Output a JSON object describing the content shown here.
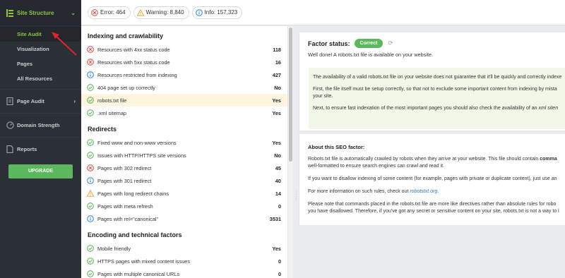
{
  "sidebar": {
    "section_title": "Site Structure",
    "sub_items": [
      {
        "label": "Site Audit",
        "active": true
      },
      {
        "label": "Visualization",
        "active": false
      },
      {
        "label": "Pages",
        "active": false
      },
      {
        "label": "All Resources",
        "active": false
      }
    ],
    "items": [
      {
        "label": "Page Audit",
        "icon": "page-audit-icon",
        "has_chevron": true
      },
      {
        "label": "Domain Strength",
        "icon": "gauge-icon",
        "has_chevron": false
      },
      {
        "label": "Reports",
        "icon": "report-icon",
        "has_chevron": false
      }
    ],
    "upgrade_label": "UPGRADE"
  },
  "topbar": {
    "error": "Error: 464",
    "warning": "Warning: 8,840",
    "info": "Info: 157,323"
  },
  "list": {
    "sections": [
      {
        "title": "Indexing and crawlability",
        "rows": [
          {
            "status": "error",
            "label": "Resources with 4xx status code",
            "value": "118"
          },
          {
            "status": "error",
            "label": "Resources with 5xx status code",
            "value": "16"
          },
          {
            "status": "info",
            "label": "Resources restricted from indexing",
            "value": "427"
          },
          {
            "status": "ok",
            "label": "404 page set up correctly",
            "value": "No"
          },
          {
            "status": "ok",
            "label": "robots.txt file",
            "value": "Yes",
            "active": true
          },
          {
            "status": "ok",
            "label": ".xml sitemap",
            "value": "Yes"
          }
        ]
      },
      {
        "title": "Redirects",
        "rows": [
          {
            "status": "ok",
            "label": "Fixed www and non-www versions",
            "value": "Yes"
          },
          {
            "status": "ok",
            "label": "Issues with HTTP/HTTPS site versions",
            "value": "No"
          },
          {
            "status": "error",
            "label": "Pages with 302 redirect",
            "value": "45"
          },
          {
            "status": "info",
            "label": "Pages with 301 redirect",
            "value": "40"
          },
          {
            "status": "warning",
            "label": "Pages with long redirect chains",
            "value": "14"
          },
          {
            "status": "ok",
            "label": "Pages with meta refresh",
            "value": "0"
          },
          {
            "status": "info",
            "label": "Pages with rel=\"canonical\"",
            "value": "3531"
          }
        ]
      },
      {
        "title": "Encoding and technical factors",
        "rows": [
          {
            "status": "ok",
            "label": "Mobile friendly",
            "value": "Yes"
          },
          {
            "status": "ok",
            "label": "HTTPS pages with mixed content issues",
            "value": "0"
          },
          {
            "status": "ok",
            "label": "Pages with multiple canonical URLs",
            "value": "0"
          }
        ]
      }
    ]
  },
  "factor": {
    "status_label": "Factor status:",
    "badge": "Correct",
    "message": "Well done! A robots.txt file is available on your website.",
    "tip_p1": "The availability of a valid robots.txt file on your website does not guarantee that it'll be quickly and correctly indexe",
    "tip_p2a": "First, the file itself must be setup correctly, so that not to exclude some important content from indexing by mista",
    "tip_p2b": "your site.",
    "tip_p3_pre": "Next, to ensure fast indexation of the most important pages you should also check the availability of an ",
    "tip_p3_em": "xml siten"
  },
  "about": {
    "title": "About this SEO factor:",
    "p1a_pre": "Robots.txt file is automatically crawled by robots when they arrive at your website. This file should contain ",
    "p1a_bold": "comma",
    "p1b": "well-formatted to ensure search engines can crawl and read it.",
    "p2": "If you want to disallow indexing of some content (for example, pages with private or duplicate content), just use an",
    "p3_pre": "For more information on such rules, check out ",
    "p3_link": "robotstxt.org",
    "p3_post": ".",
    "p4a": "Please note that commands placed in the robots.txt file are more like directives rather than absolute rules for robo",
    "p4b": "you have disallowed. Therefore, if you've got any secret or sensitive content on your site, robots.txt is not a way to l"
  },
  "colors": {
    "accent": "#8cc63f",
    "ok": "#5cb85c",
    "error": "#d9534f",
    "warning": "#f0ad4e",
    "info": "#3a8fd0"
  }
}
